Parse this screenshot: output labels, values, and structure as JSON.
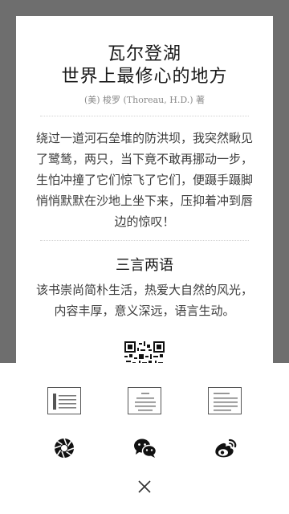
{
  "card": {
    "title_line1": "瓦尔登湖",
    "title_line2": "世界上最修心的地方",
    "author": "(美) 梭罗 (Thoreau, H.D.) 著",
    "quote": "绕过一道河石垒堆的防洪坝，我突然瞅见了鹭鸶，两只，当下竟不敢再挪动一步，生怕冲撞了它们惊飞了它们，便蹑手蹑脚悄悄默默在沙地上坐下来，压抑着冲到唇边的惊叹！",
    "section_title": "三言两语",
    "description": "该书崇尚简朴生活，热爱大自然的风光，内容丰厚，意义深远，语言生动。"
  },
  "share_sheet": {
    "layout_options": [
      {
        "icon": "layout-left-aligned-icon"
      },
      {
        "icon": "layout-centered-icon"
      },
      {
        "icon": "layout-text-icon"
      }
    ],
    "targets": [
      {
        "icon": "aperture-icon"
      },
      {
        "icon": "wechat-icon"
      },
      {
        "icon": "weibo-icon"
      }
    ],
    "close_icon": "close-icon"
  },
  "colors": {
    "backdrop": "#6e6e6e",
    "card": "#ffffff",
    "text": "#1a1a1a",
    "muted": "#8a8a8a"
  }
}
